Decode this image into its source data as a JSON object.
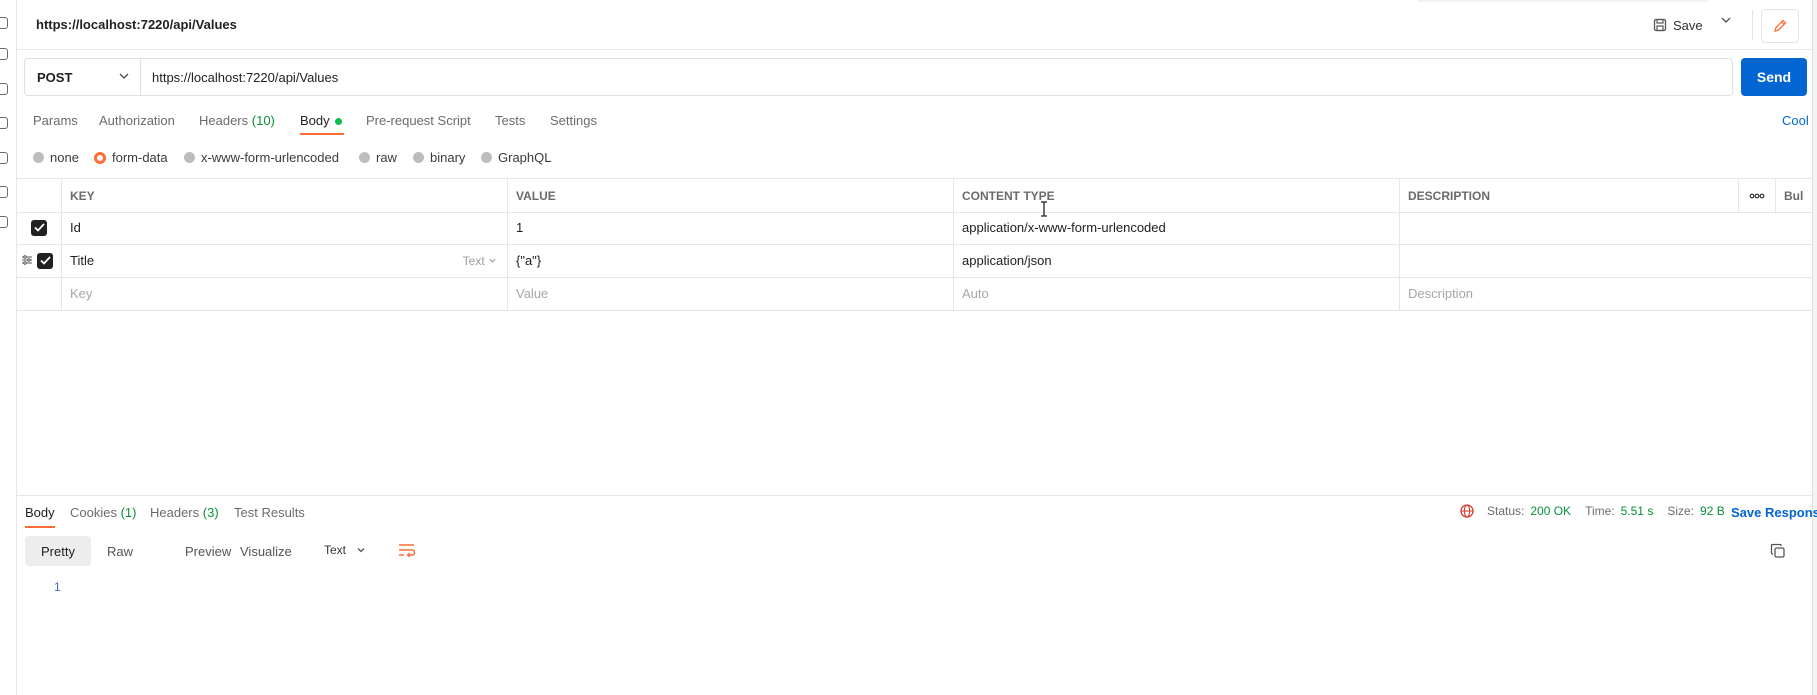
{
  "header": {
    "title": "https://localhost:7220/api/Values",
    "save_label": "Save"
  },
  "request": {
    "method": "POST",
    "url": "https://localhost:7220/api/Values",
    "send_label": "Send",
    "tabs": {
      "params": "Params",
      "authorization": "Authorization",
      "headers": "Headers",
      "headers_count": "(10)",
      "body": "Body",
      "pre_request": "Pre-request Script",
      "tests": "Tests",
      "settings": "Settings"
    },
    "cookies_link": "Cool",
    "body_types": [
      "none",
      "form-data",
      "x-www-form-urlencoded",
      "raw",
      "binary",
      "GraphQL"
    ],
    "selected_body_type": "form-data"
  },
  "table": {
    "headers": {
      "key": "KEY",
      "value": "VALUE",
      "content_type": "CONTENT TYPE",
      "description": "DESCRIPTION",
      "bulk": "Bul"
    },
    "rows": [
      {
        "key": "Id",
        "value": "1",
        "content_type": "application/x-www-form-urlencoded",
        "description": ""
      },
      {
        "key": "Title",
        "type": "Text",
        "value": "{\"a\"}",
        "content_type": "application/json",
        "description": ""
      }
    ],
    "placeholder": {
      "key": "Key",
      "value": "Value",
      "content_type": "Auto",
      "description": "Description"
    }
  },
  "response": {
    "tabs": {
      "body": "Body",
      "cookies": "Cookies",
      "cookies_count": "(1)",
      "headers": "Headers",
      "headers_count": "(3)",
      "test_results": "Test Results"
    },
    "status_label": "Status:",
    "status_value": "200 OK",
    "time_label": "Time:",
    "time_value": "5.51 s",
    "size_label": "Size:",
    "size_value": "92 B",
    "save_response": "Save Respons",
    "views": [
      "Pretty",
      "Raw",
      "Preview",
      "Visualize"
    ],
    "format": "Text",
    "line_numbers": [
      "1"
    ]
  },
  "colors": {
    "accent": "#ff6c37",
    "primary_button": "#0265d2",
    "status_ok": "#0a8f3a"
  }
}
